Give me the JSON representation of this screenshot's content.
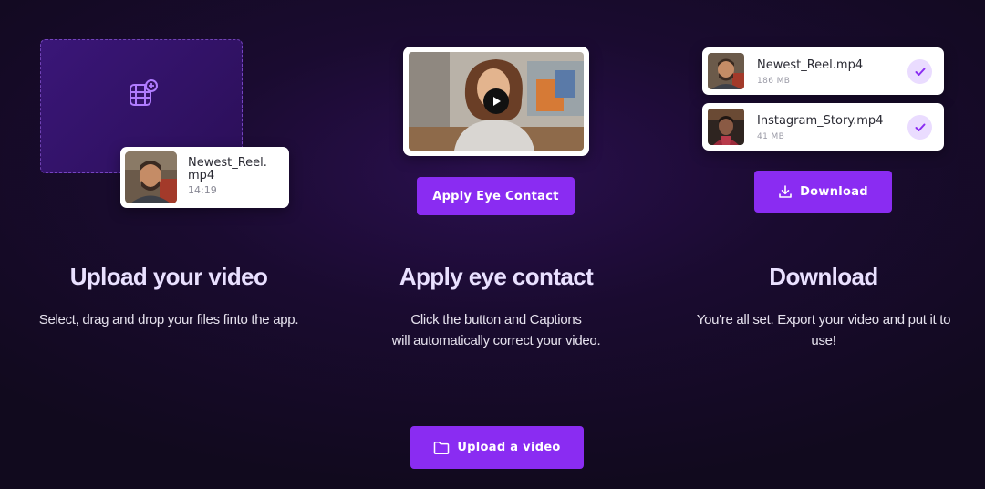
{
  "colors": {
    "accent": "#8a2cf2",
    "background": "#1a0b30",
    "check_bg": "#eadcff",
    "check_mark": "#8a2cf2"
  },
  "step_upload": {
    "title": "Upload your video",
    "description": "Select, drag and drop your files finto the app.",
    "dropzone_icon": "video-add-icon",
    "file": {
      "name": "Newest_Reel.\nmp4",
      "duration": "14:19"
    }
  },
  "step_eye": {
    "title": "Apply eye contact",
    "description_line1": "Click the button and Captions",
    "description_line2": "will automatically correct your video.",
    "button_label": "Apply Eye Contact",
    "play_icon": "play-icon"
  },
  "step_download": {
    "title": "Download",
    "description_line1": "You're all set. Export your video and put it to",
    "description_line2": "use!",
    "button_label": "Download",
    "button_icon": "download-icon",
    "files": [
      {
        "name": "Newest_Reel.mp4",
        "size": "186 MB",
        "status_icon": "check-icon"
      },
      {
        "name": "Instagram_Story.mp4",
        "size": "41 MB",
        "status_icon": "check-icon"
      }
    ]
  },
  "cta": {
    "label": "Upload a video",
    "icon": "folder-icon"
  }
}
